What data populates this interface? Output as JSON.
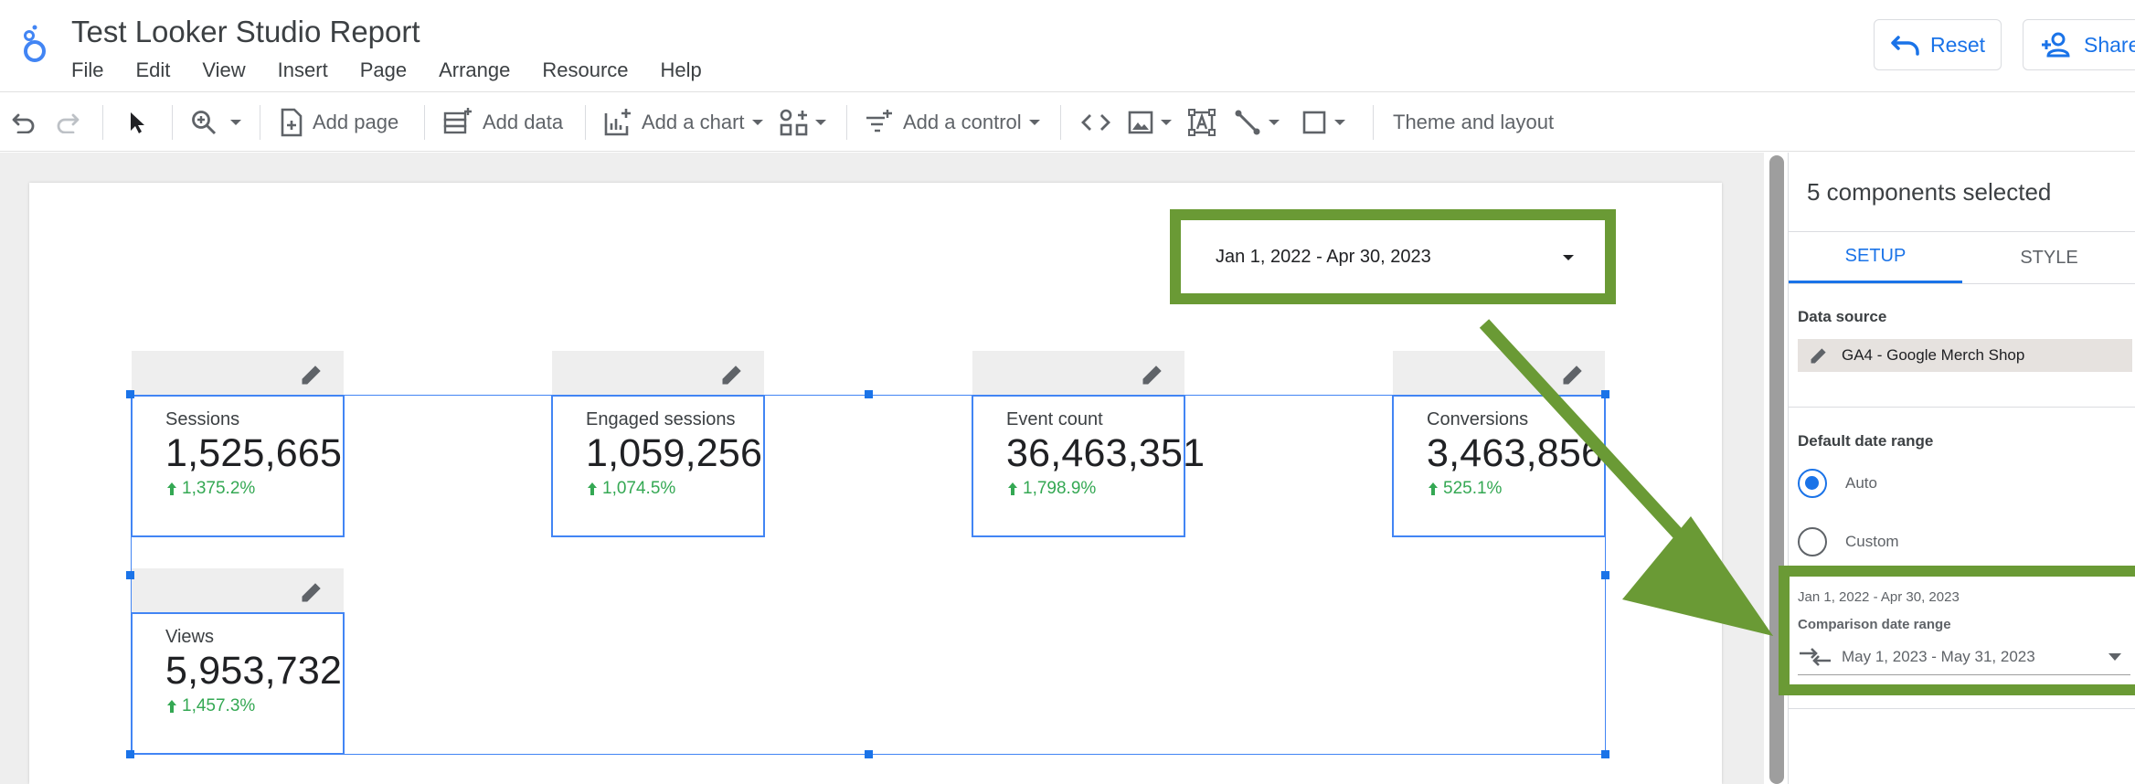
{
  "app": {
    "title": "Test Looker Studio Report",
    "menu": [
      "File",
      "Edit",
      "View",
      "Insert",
      "Page",
      "Arrange",
      "Resource",
      "Help"
    ],
    "reset_label": "Reset",
    "share_label": "Share"
  },
  "toolbar": {
    "add_page": "Add page",
    "add_data": "Add data",
    "add_chart": "Add a chart",
    "add_control": "Add a control",
    "theme_layout": "Theme and layout"
  },
  "canvas": {
    "date_range": "Jan 1, 2022 - Apr 30, 2023",
    "scorecards": [
      {
        "label": "Sessions",
        "value": "1,525,665",
        "delta": "1,375.2%"
      },
      {
        "label": "Engaged sessions",
        "value": "1,059,256",
        "delta": "1,074.5%"
      },
      {
        "label": "Event count",
        "value": "36,463,351",
        "delta": "1,798.9%"
      },
      {
        "label": "Conversions",
        "value": "3,463,856",
        "delta": "525.1%"
      },
      {
        "label": "Views",
        "value": "5,953,732",
        "delta": "1,457.3%"
      }
    ]
  },
  "panel": {
    "title": "5 components selected",
    "tab_setup": "SETUP",
    "tab_style": "STYLE",
    "data_source_label": "Data source",
    "data_source": "GA4 - Google Merch Shop",
    "default_date_range_label": "Default date range",
    "option_auto": "Auto",
    "option_custom": "Custom",
    "range_summary": "Jan 1, 2022 - Apr 30, 2023",
    "comparison_label": "Comparison date range",
    "comparison_value": "May 1, 2023 - May 31, 2023"
  },
  "colors": {
    "accent": "#1a73e8",
    "positive": "#34a853",
    "highlight": "#6a9a35"
  }
}
